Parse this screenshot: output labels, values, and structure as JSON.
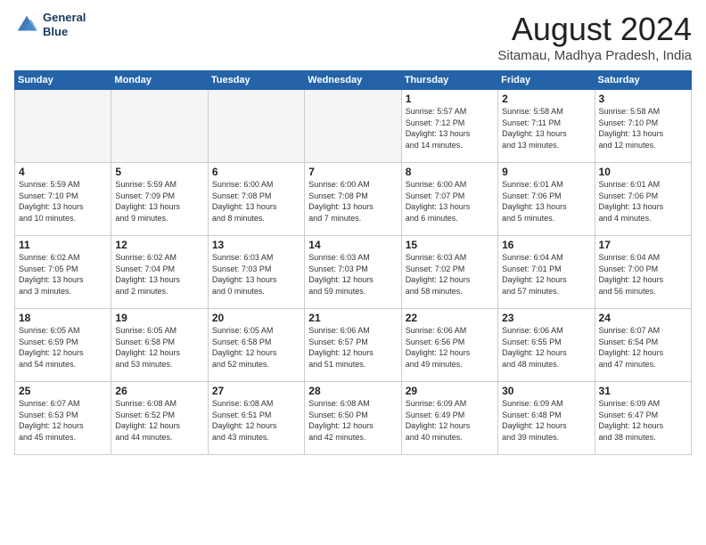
{
  "logo": {
    "line1": "General",
    "line2": "Blue"
  },
  "title": "August 2024",
  "subtitle": "Sitamau, Madhya Pradesh, India",
  "days_of_week": [
    "Sunday",
    "Monday",
    "Tuesday",
    "Wednesday",
    "Thursday",
    "Friday",
    "Saturday"
  ],
  "weeks": [
    [
      {
        "day": "",
        "info": ""
      },
      {
        "day": "",
        "info": ""
      },
      {
        "day": "",
        "info": ""
      },
      {
        "day": "",
        "info": ""
      },
      {
        "day": "1",
        "info": "Sunrise: 5:57 AM\nSunset: 7:12 PM\nDaylight: 13 hours\nand 14 minutes."
      },
      {
        "day": "2",
        "info": "Sunrise: 5:58 AM\nSunset: 7:11 PM\nDaylight: 13 hours\nand 13 minutes."
      },
      {
        "day": "3",
        "info": "Sunrise: 5:58 AM\nSunset: 7:10 PM\nDaylight: 13 hours\nand 12 minutes."
      }
    ],
    [
      {
        "day": "4",
        "info": "Sunrise: 5:59 AM\nSunset: 7:10 PM\nDaylight: 13 hours\nand 10 minutes."
      },
      {
        "day": "5",
        "info": "Sunrise: 5:59 AM\nSunset: 7:09 PM\nDaylight: 13 hours\nand 9 minutes."
      },
      {
        "day": "6",
        "info": "Sunrise: 6:00 AM\nSunset: 7:08 PM\nDaylight: 13 hours\nand 8 minutes."
      },
      {
        "day": "7",
        "info": "Sunrise: 6:00 AM\nSunset: 7:08 PM\nDaylight: 13 hours\nand 7 minutes."
      },
      {
        "day": "8",
        "info": "Sunrise: 6:00 AM\nSunset: 7:07 PM\nDaylight: 13 hours\nand 6 minutes."
      },
      {
        "day": "9",
        "info": "Sunrise: 6:01 AM\nSunset: 7:06 PM\nDaylight: 13 hours\nand 5 minutes."
      },
      {
        "day": "10",
        "info": "Sunrise: 6:01 AM\nSunset: 7:06 PM\nDaylight: 13 hours\nand 4 minutes."
      }
    ],
    [
      {
        "day": "11",
        "info": "Sunrise: 6:02 AM\nSunset: 7:05 PM\nDaylight: 13 hours\nand 3 minutes."
      },
      {
        "day": "12",
        "info": "Sunrise: 6:02 AM\nSunset: 7:04 PM\nDaylight: 13 hours\nand 2 minutes."
      },
      {
        "day": "13",
        "info": "Sunrise: 6:03 AM\nSunset: 7:03 PM\nDaylight: 13 hours\nand 0 minutes."
      },
      {
        "day": "14",
        "info": "Sunrise: 6:03 AM\nSunset: 7:03 PM\nDaylight: 12 hours\nand 59 minutes."
      },
      {
        "day": "15",
        "info": "Sunrise: 6:03 AM\nSunset: 7:02 PM\nDaylight: 12 hours\nand 58 minutes."
      },
      {
        "day": "16",
        "info": "Sunrise: 6:04 AM\nSunset: 7:01 PM\nDaylight: 12 hours\nand 57 minutes."
      },
      {
        "day": "17",
        "info": "Sunrise: 6:04 AM\nSunset: 7:00 PM\nDaylight: 12 hours\nand 56 minutes."
      }
    ],
    [
      {
        "day": "18",
        "info": "Sunrise: 6:05 AM\nSunset: 6:59 PM\nDaylight: 12 hours\nand 54 minutes."
      },
      {
        "day": "19",
        "info": "Sunrise: 6:05 AM\nSunset: 6:58 PM\nDaylight: 12 hours\nand 53 minutes."
      },
      {
        "day": "20",
        "info": "Sunrise: 6:05 AM\nSunset: 6:58 PM\nDaylight: 12 hours\nand 52 minutes."
      },
      {
        "day": "21",
        "info": "Sunrise: 6:06 AM\nSunset: 6:57 PM\nDaylight: 12 hours\nand 51 minutes."
      },
      {
        "day": "22",
        "info": "Sunrise: 6:06 AM\nSunset: 6:56 PM\nDaylight: 12 hours\nand 49 minutes."
      },
      {
        "day": "23",
        "info": "Sunrise: 6:06 AM\nSunset: 6:55 PM\nDaylight: 12 hours\nand 48 minutes."
      },
      {
        "day": "24",
        "info": "Sunrise: 6:07 AM\nSunset: 6:54 PM\nDaylight: 12 hours\nand 47 minutes."
      }
    ],
    [
      {
        "day": "25",
        "info": "Sunrise: 6:07 AM\nSunset: 6:53 PM\nDaylight: 12 hours\nand 45 minutes."
      },
      {
        "day": "26",
        "info": "Sunrise: 6:08 AM\nSunset: 6:52 PM\nDaylight: 12 hours\nand 44 minutes."
      },
      {
        "day": "27",
        "info": "Sunrise: 6:08 AM\nSunset: 6:51 PM\nDaylight: 12 hours\nand 43 minutes."
      },
      {
        "day": "28",
        "info": "Sunrise: 6:08 AM\nSunset: 6:50 PM\nDaylight: 12 hours\nand 42 minutes."
      },
      {
        "day": "29",
        "info": "Sunrise: 6:09 AM\nSunset: 6:49 PM\nDaylight: 12 hours\nand 40 minutes."
      },
      {
        "day": "30",
        "info": "Sunrise: 6:09 AM\nSunset: 6:48 PM\nDaylight: 12 hours\nand 39 minutes."
      },
      {
        "day": "31",
        "info": "Sunrise: 6:09 AM\nSunset: 6:47 PM\nDaylight: 12 hours\nand 38 minutes."
      }
    ]
  ]
}
